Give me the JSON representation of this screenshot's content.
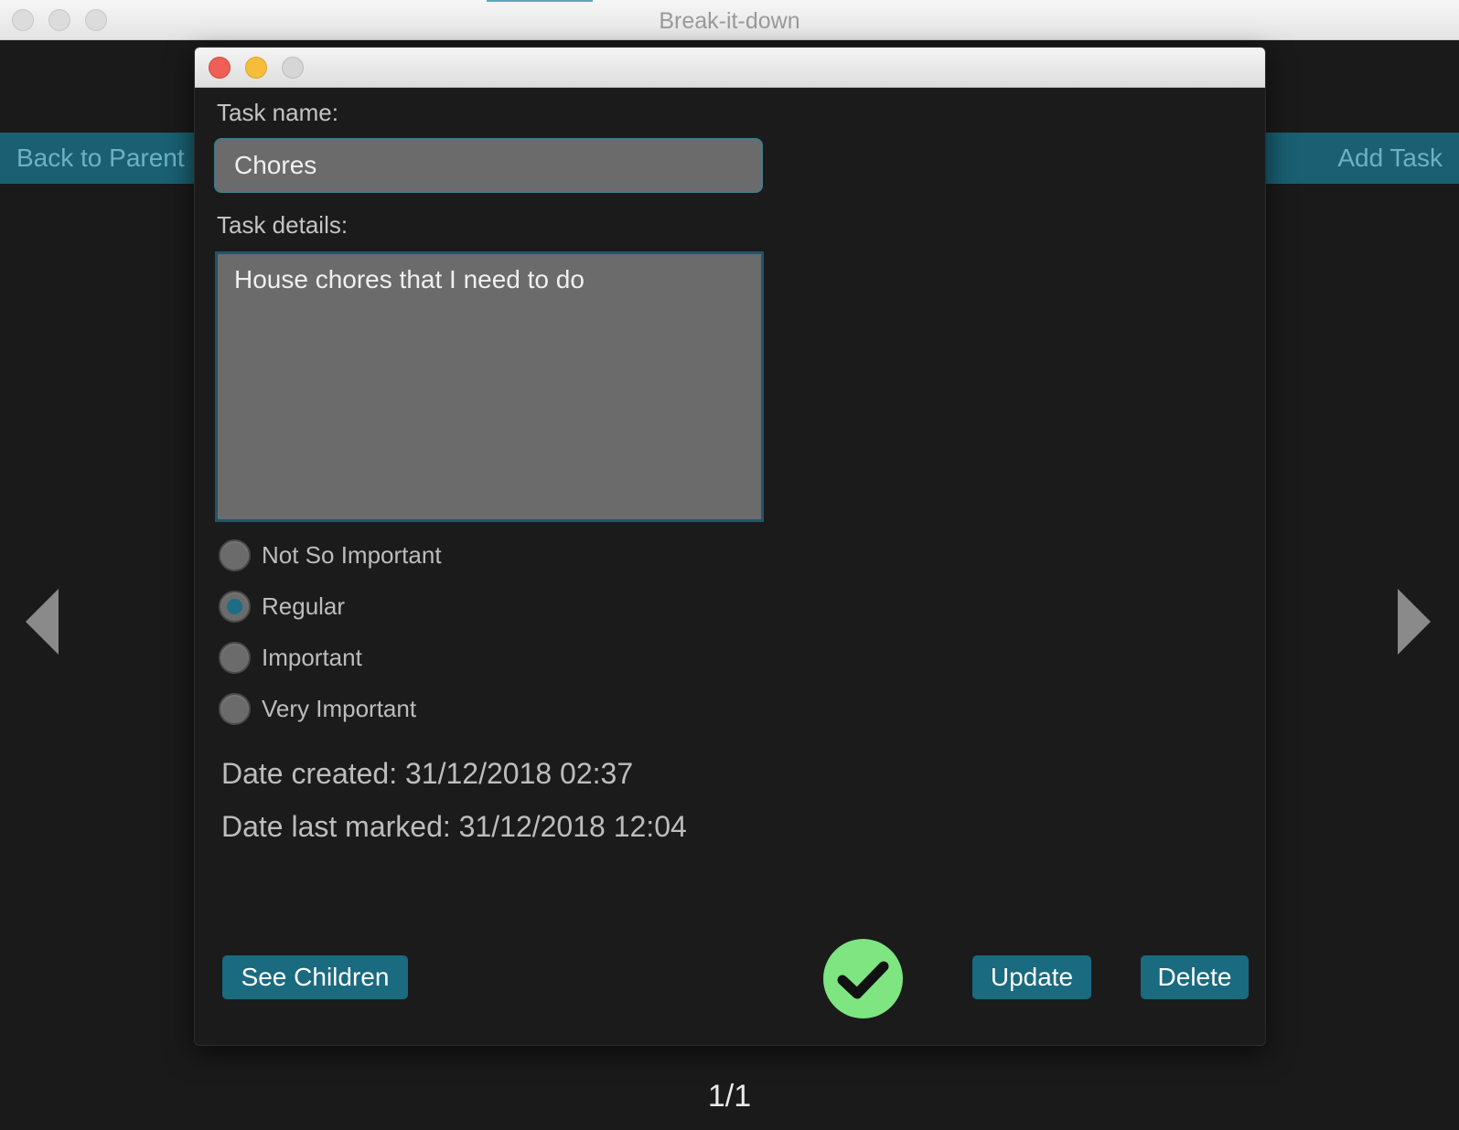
{
  "window": {
    "title": "Break-it-down"
  },
  "toolbar": {
    "back_label": "Back to Parent",
    "add_label": "Add Task"
  },
  "pager": {
    "counter": "1/1"
  },
  "dialog": {
    "task_name_label": "Task name:",
    "task_name_value": "Chores",
    "task_details_label": "Task details:",
    "task_details_value": "House chores that I need to do",
    "priorities": [
      {
        "label": "Not So Important",
        "selected": false
      },
      {
        "label": "Regular",
        "selected": true
      },
      {
        "label": "Important",
        "selected": false
      },
      {
        "label": "Very Important",
        "selected": false
      }
    ],
    "date_created": "Date created: 31/12/2018 02:37",
    "date_last_marked": "Date last marked: 31/12/2018 12:04",
    "see_children_label": "See Children",
    "update_label": "Update",
    "delete_label": "Delete",
    "completion_icon": "checkmark-icon"
  },
  "colors": {
    "accent": "#1a6a80",
    "background": "#1a1a1a",
    "checkmark_bg": "#7ee581"
  }
}
